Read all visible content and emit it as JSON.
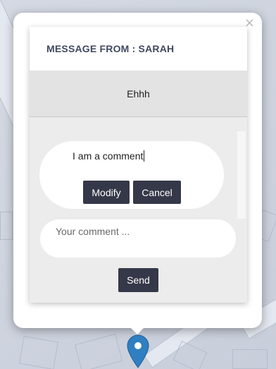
{
  "popup": {
    "close_label": "×",
    "header_title": "MESSAGE FROM : SARAH",
    "message_text": "Ehhh"
  },
  "comment_edit": {
    "value": "I am a comment",
    "modify_label": "Modify",
    "cancel_label": "Cancel"
  },
  "new_comment": {
    "placeholder": "Your comment ...",
    "send_label": "Send"
  },
  "colors": {
    "button_bg": "#353848",
    "header_text": "#3f4960",
    "marker": "#2f7fc1"
  },
  "icons": {
    "close": "close-icon",
    "marker": "map-marker-icon"
  }
}
